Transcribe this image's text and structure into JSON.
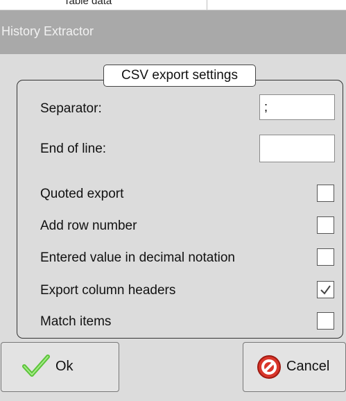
{
  "background": {
    "partial_text": "Table data"
  },
  "dialog": {
    "title": "History Extractor",
    "group_title": "CSV export settings",
    "separator": {
      "label": "Separator:",
      "value": ";"
    },
    "end_of_line": {
      "label": "End of line:",
      "value": ""
    },
    "options": [
      {
        "label": "Quoted export",
        "checked": false
      },
      {
        "label": "Add row number",
        "checked": false
      },
      {
        "label": "Entered value in decimal notation",
        "checked": false
      },
      {
        "label": "Export column headers",
        "checked": true
      },
      {
        "label": "Match items",
        "checked": false
      }
    ],
    "buttons": {
      "ok_label": "Ok",
      "cancel_label": "Cancel"
    }
  },
  "colors": {
    "ok_icon": "#5cc43a",
    "cancel_icon": "#d9362b"
  }
}
